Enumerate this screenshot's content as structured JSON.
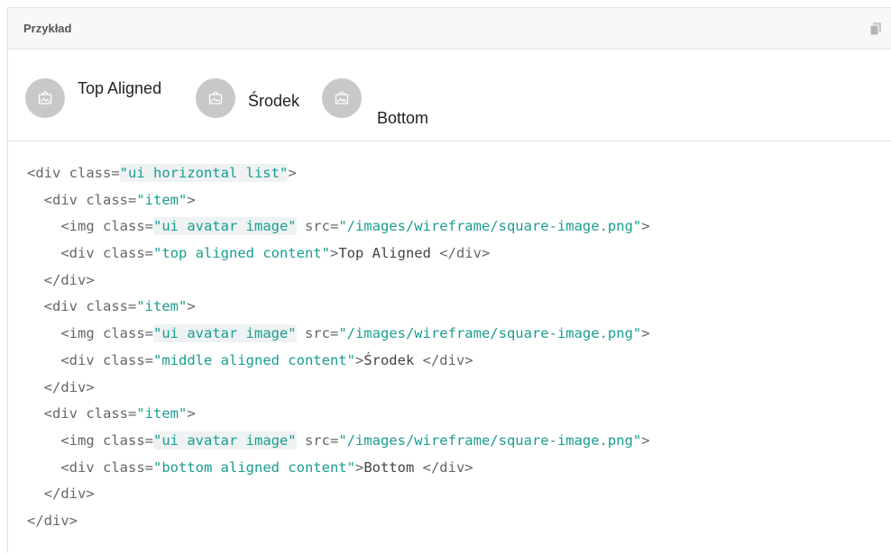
{
  "header": {
    "title": "Przykład",
    "copy_icon": "copy-icon"
  },
  "example": {
    "items": [
      {
        "label": "Top Aligned",
        "icon": "image-icon"
      },
      {
        "label": "Środek",
        "icon": "image-icon"
      },
      {
        "label": "Bottom",
        "icon": "image-icon"
      }
    ]
  },
  "colors": {
    "string": "#1a9d8f",
    "tag": "#666666",
    "avatar": "#c8c8c8",
    "header_bg": "#f8f8f9"
  },
  "code": {
    "lines": [
      [
        {
          "t": "tag",
          "v": "<div "
        },
        {
          "t": "attr",
          "v": "class="
        },
        {
          "t": "str",
          "v": "\"ui horizontal list\"",
          "hl": true
        },
        {
          "t": "tag",
          "v": ">"
        }
      ],
      [
        {
          "t": "tag",
          "v": "  <div "
        },
        {
          "t": "attr",
          "v": "class="
        },
        {
          "t": "str",
          "v": "\"item\""
        },
        {
          "t": "tag",
          "v": ">"
        }
      ],
      [
        {
          "t": "tag",
          "v": "    <img "
        },
        {
          "t": "attr",
          "v": "class="
        },
        {
          "t": "str",
          "v": "\"ui avatar image\"",
          "hl": true
        },
        {
          "t": "attr",
          "v": " src="
        },
        {
          "t": "str",
          "v": "\"/images/wireframe/square-image.png\""
        },
        {
          "t": "tag",
          "v": ">"
        }
      ],
      [
        {
          "t": "tag",
          "v": "    <div "
        },
        {
          "t": "attr",
          "v": "class="
        },
        {
          "t": "str",
          "v": "\"top aligned content\""
        },
        {
          "t": "tag",
          "v": ">"
        },
        {
          "t": "txt",
          "v": "Top Aligned "
        },
        {
          "t": "tag",
          "v": "</div>"
        }
      ],
      [
        {
          "t": "tag",
          "v": "  </div>"
        }
      ],
      [
        {
          "t": "tag",
          "v": "  <div "
        },
        {
          "t": "attr",
          "v": "class="
        },
        {
          "t": "str",
          "v": "\"item\""
        },
        {
          "t": "tag",
          "v": ">"
        }
      ],
      [
        {
          "t": "tag",
          "v": "    <img "
        },
        {
          "t": "attr",
          "v": "class="
        },
        {
          "t": "str",
          "v": "\"ui avatar image\"",
          "hl": true
        },
        {
          "t": "attr",
          "v": " src="
        },
        {
          "t": "str",
          "v": "\"/images/wireframe/square-image.png\""
        },
        {
          "t": "tag",
          "v": ">"
        }
      ],
      [
        {
          "t": "tag",
          "v": "    <div "
        },
        {
          "t": "attr",
          "v": "class="
        },
        {
          "t": "str",
          "v": "\"middle aligned content\""
        },
        {
          "t": "tag",
          "v": ">"
        },
        {
          "t": "txt",
          "v": "Środek "
        },
        {
          "t": "tag",
          "v": "</div>"
        }
      ],
      [
        {
          "t": "tag",
          "v": "  </div>"
        }
      ],
      [
        {
          "t": "tag",
          "v": "  <div "
        },
        {
          "t": "attr",
          "v": "class="
        },
        {
          "t": "str",
          "v": "\"item\""
        },
        {
          "t": "tag",
          "v": ">"
        }
      ],
      [
        {
          "t": "tag",
          "v": "    <img "
        },
        {
          "t": "attr",
          "v": "class="
        },
        {
          "t": "str",
          "v": "\"ui avatar image\"",
          "hl": true
        },
        {
          "t": "attr",
          "v": " src="
        },
        {
          "t": "str",
          "v": "\"/images/wireframe/square-image.png\""
        },
        {
          "t": "tag",
          "v": ">"
        }
      ],
      [
        {
          "t": "tag",
          "v": "    <div "
        },
        {
          "t": "attr",
          "v": "class="
        },
        {
          "t": "str",
          "v": "\"bottom aligned content\""
        },
        {
          "t": "tag",
          "v": ">"
        },
        {
          "t": "txt",
          "v": "Bottom "
        },
        {
          "t": "tag",
          "v": "</div>"
        }
      ],
      [
        {
          "t": "tag",
          "v": "  </div>"
        }
      ],
      [
        {
          "t": "tag",
          "v": "</div>"
        }
      ]
    ]
  }
}
